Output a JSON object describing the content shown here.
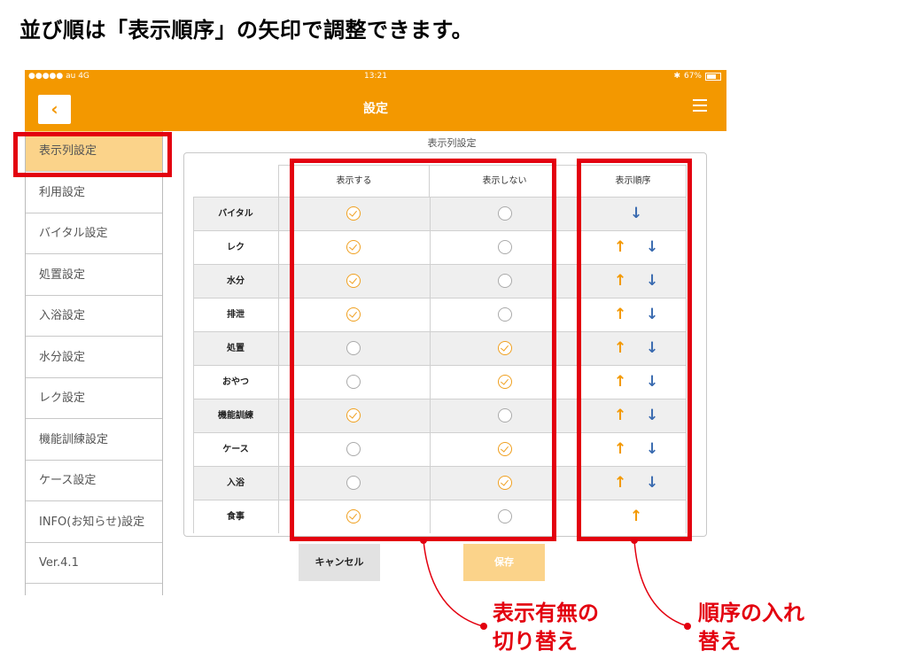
{
  "heading": "並び順は「表示順序」の矢印で調整できます。",
  "statusbar": {
    "left": "●●●●● au  4G",
    "time": "13:21",
    "battery": "67%"
  },
  "navbar": {
    "back": "‹",
    "title": "設定"
  },
  "sidebar": {
    "items": [
      {
        "label": "表示列設定",
        "active": true
      },
      {
        "label": "利用設定"
      },
      {
        "label": "バイタル設定"
      },
      {
        "label": "処置設定"
      },
      {
        "label": "入浴設定"
      },
      {
        "label": "水分設定"
      },
      {
        "label": "レク設定"
      },
      {
        "label": "機能訓練設定"
      },
      {
        "label": "ケース設定"
      },
      {
        "label": "INFO(お知らせ)設定"
      },
      {
        "label": "Ver.4.1"
      }
    ]
  },
  "panel": {
    "title": "表示列設定",
    "headers": {
      "show": "表示する",
      "hide": "表示しない",
      "order": "表示順序"
    },
    "rows": [
      {
        "label": "バイタル",
        "show": true,
        "up": false,
        "down": true
      },
      {
        "label": "レク",
        "show": true,
        "up": true,
        "down": true
      },
      {
        "label": "水分",
        "show": true,
        "up": true,
        "down": true
      },
      {
        "label": "排泄",
        "show": true,
        "up": true,
        "down": true
      },
      {
        "label": "処置",
        "show": false,
        "up": true,
        "down": true
      },
      {
        "label": "おやつ",
        "show": false,
        "up": true,
        "down": true
      },
      {
        "label": "機能訓練",
        "show": true,
        "up": true,
        "down": true
      },
      {
        "label": "ケース",
        "show": false,
        "up": true,
        "down": true
      },
      {
        "label": "入浴",
        "show": false,
        "up": true,
        "down": true
      },
      {
        "label": "食事",
        "show": true,
        "up": true,
        "down": false
      }
    ]
  },
  "buttons": {
    "cancel": "キャンセル",
    "save": "保存"
  },
  "callouts": {
    "toggle_line1": "表示有無の",
    "toggle_line2": "切り替え",
    "order_line1": "順序の入れ",
    "order_line2": "替え"
  },
  "colors": {
    "accent": "#f39800",
    "annotation": "#e3000f",
    "arrow_down": "#3a6bb0"
  }
}
